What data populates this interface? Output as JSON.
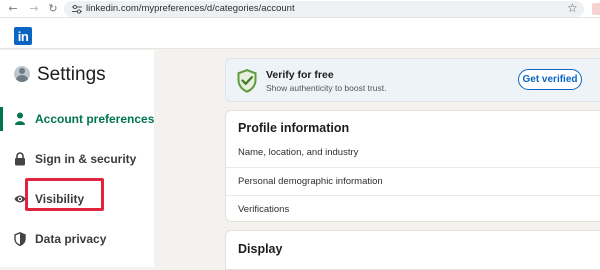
{
  "browser": {
    "url": "linkedin.com/mypreferences/d/categories/account",
    "icons": [
      "arrow-left-icon",
      "arrow-right-icon",
      "reload-icon",
      "tune-icon",
      "star-icon"
    ]
  },
  "header": {
    "logo_text": "in",
    "brand_color": "#0a66c2"
  },
  "sidebar": {
    "title": "Settings",
    "accent_color": "#01754f",
    "items": [
      {
        "label": "Account preferences",
        "icon": "person-icon",
        "active": true
      },
      {
        "label": "Sign in & security",
        "icon": "lock-icon",
        "active": false
      },
      {
        "label": "Visibility",
        "icon": "eye-icon",
        "active": false,
        "highlighted": true
      },
      {
        "label": "Data privacy",
        "icon": "shield-half-icon",
        "active": false
      }
    ]
  },
  "verify": {
    "title": "Verify for free",
    "subtitle": "Show authenticity to boost trust.",
    "button_label": "Get verified"
  },
  "profile_information": {
    "heading": "Profile information",
    "rows": [
      {
        "label": "Name, location, and industry"
      },
      {
        "label": "Personal demographic information"
      },
      {
        "label": "Verifications"
      }
    ]
  },
  "display": {
    "heading": "Display"
  },
  "annotation": {
    "highlight_color": "#e0243d"
  }
}
